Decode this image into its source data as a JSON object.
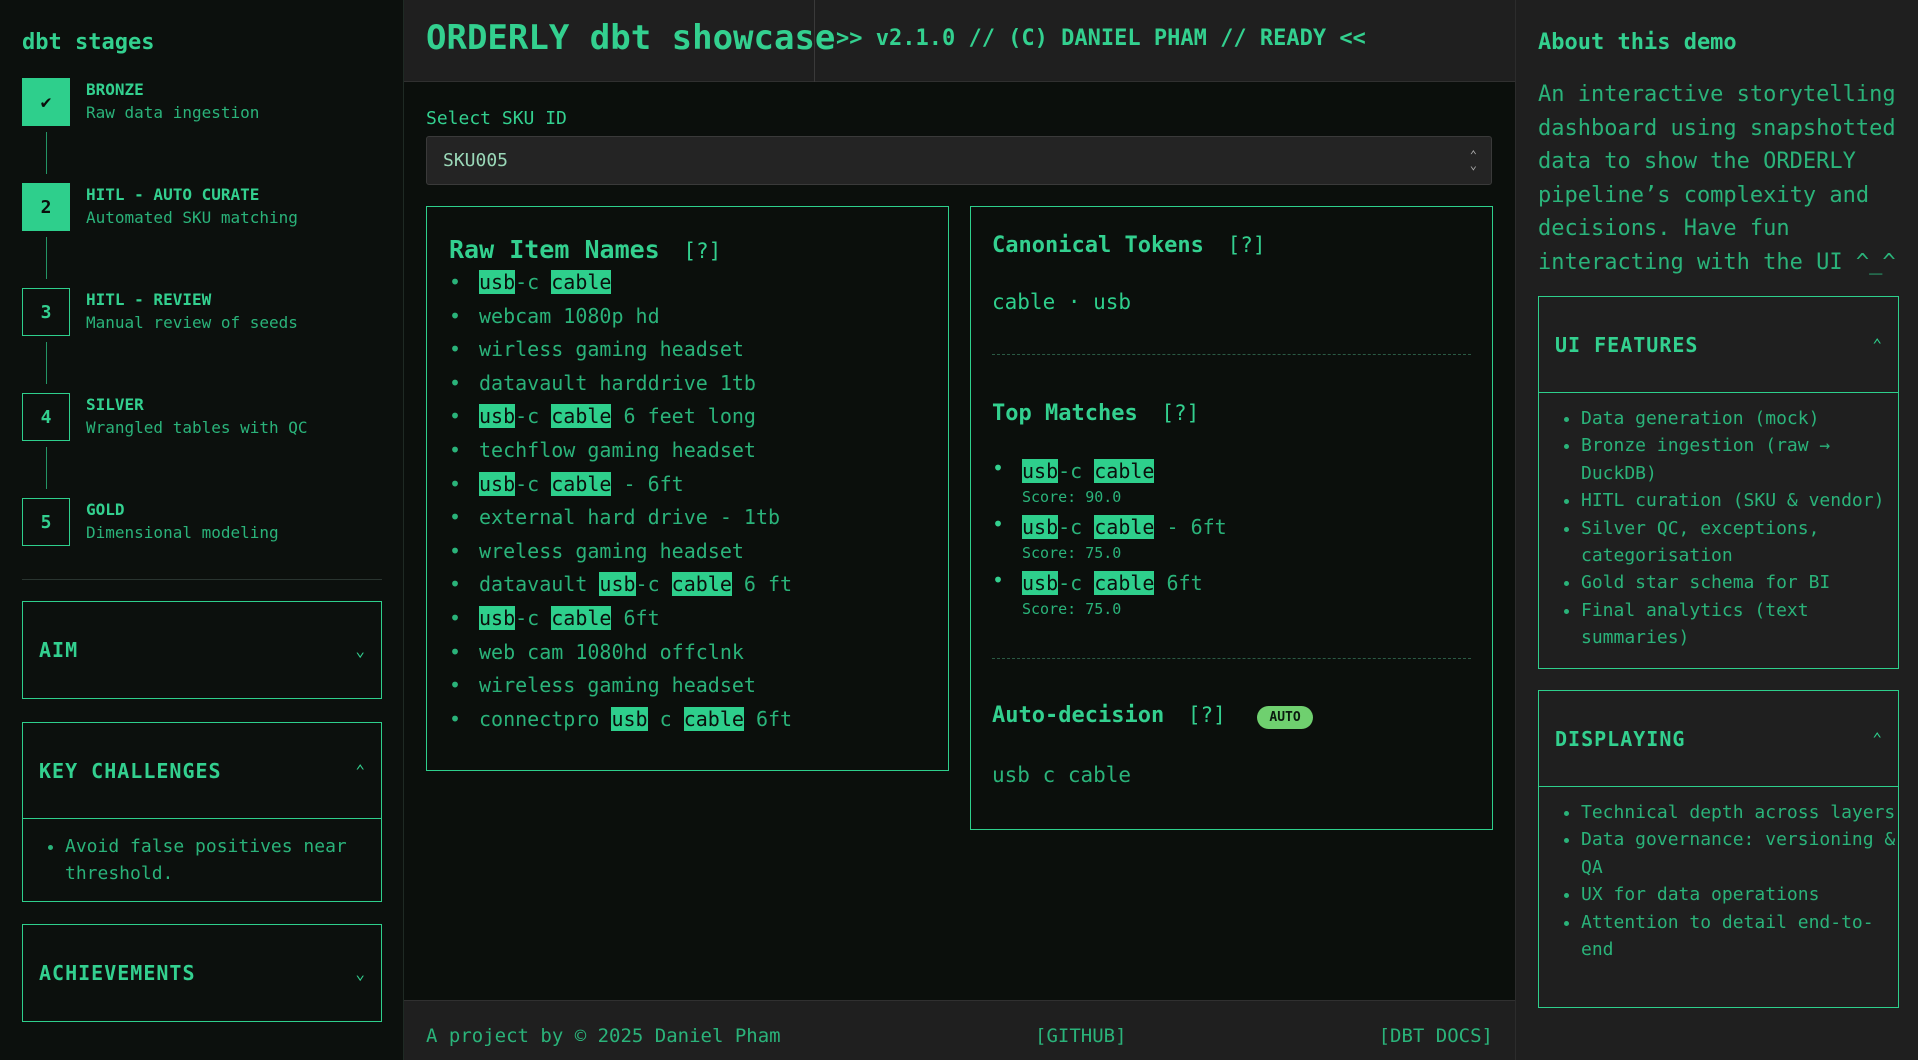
{
  "left": {
    "title": "dbt stages",
    "stages": [
      {
        "box": "✔",
        "name": "BRONZE",
        "desc": "Raw data ingestion"
      },
      {
        "box": "2",
        "name": "HITL - AUTO CURATE",
        "desc": "Automated SKU matching"
      },
      {
        "box": "3",
        "name": "HITL - REVIEW",
        "desc": "Manual review of seeds"
      },
      {
        "box": "4",
        "name": "SILVER",
        "desc": "Wrangled tables with QC"
      },
      {
        "box": "5",
        "name": "GOLD",
        "desc": "Dimensional modeling"
      }
    ],
    "accordions": {
      "aim": {
        "label": "AIM",
        "chevron": "⌄"
      },
      "challenges": {
        "label": "KEY CHALLENGES",
        "chevron": "⌃",
        "items": [
          "Avoid false positives near threshold."
        ]
      },
      "achievements": {
        "label": "ACHIEVEMENTS",
        "chevron": "⌄"
      }
    }
  },
  "topbar": {
    "brand": "ORDERLY dbt showcase",
    "status": ">> v2.1.0 // (C) DANIEL PHAM // READY <<"
  },
  "sku": {
    "label": "Select SKU ID",
    "value": "SKU005"
  },
  "raw": {
    "title": "Raw Item Names",
    "help": "[?]",
    "items": [
      [
        [
          "usb",
          true
        ],
        [
          "-c ",
          false
        ],
        [
          "cable",
          true
        ]
      ],
      [
        [
          "webcam 1080p hd",
          false
        ]
      ],
      [
        [
          "wirless gaming headset",
          false
        ]
      ],
      [
        [
          "datavault harddrive 1tb",
          false
        ]
      ],
      [
        [
          "usb",
          true
        ],
        [
          "-c ",
          false
        ],
        [
          "cable",
          true
        ],
        [
          " 6 feet long",
          false
        ]
      ],
      [
        [
          "techflow gaming headset",
          false
        ]
      ],
      [
        [
          "usb",
          true
        ],
        [
          "-c ",
          false
        ],
        [
          "cable",
          true
        ],
        [
          " - 6ft",
          false
        ]
      ],
      [
        [
          "external hard drive - 1tb",
          false
        ]
      ],
      [
        [
          "wreless gaming headset",
          false
        ]
      ],
      [
        [
          "datavault ",
          false
        ],
        [
          "usb",
          true
        ],
        [
          "-c ",
          false
        ],
        [
          "cable",
          true
        ],
        [
          " 6 ft",
          false
        ]
      ],
      [
        [
          "usb",
          true
        ],
        [
          "-c ",
          false
        ],
        [
          "cable",
          true
        ],
        [
          " 6ft",
          false
        ]
      ],
      [
        [
          "web cam 1080hd offclnk",
          false
        ]
      ],
      [
        [
          "wireless gaming headset",
          false
        ]
      ],
      [
        [
          "connectpro ",
          false
        ],
        [
          "usb",
          true
        ],
        [
          " c ",
          false
        ],
        [
          "cable",
          true
        ],
        [
          " 6ft",
          false
        ]
      ]
    ]
  },
  "canonical": {
    "title": "Canonical Tokens",
    "help": "[?]",
    "tokens": "cable · usb"
  },
  "matches": {
    "title": "Top Matches",
    "help": "[?]",
    "items": [
      {
        "parts": [
          [
            "usb",
            true
          ],
          [
            "-c ",
            false
          ],
          [
            "cable",
            true
          ]
        ],
        "score": "Score: 90.0"
      },
      {
        "parts": [
          [
            "usb",
            true
          ],
          [
            "-c ",
            false
          ],
          [
            "cable",
            true
          ],
          [
            " - 6ft",
            false
          ]
        ],
        "score": "Score: 75.0"
      },
      {
        "parts": [
          [
            "usb",
            true
          ],
          [
            "-c ",
            false
          ],
          [
            "cable",
            true
          ],
          [
            " 6ft",
            false
          ]
        ],
        "score": "Score: 75.0"
      }
    ]
  },
  "decision": {
    "title": "Auto-decision",
    "help": "[?]",
    "badge": "AUTO",
    "value": "usb c cable"
  },
  "footer": {
    "credit": "A project by © 2025 Daniel Pham",
    "github": "[GITHUB]",
    "docs": "[DBT DOCS]"
  },
  "right": {
    "about_title": "About this demo",
    "about_text": "An interactive storytelling dashboard using snapshotted data to show the ORDERLY pipeline’s complexity and decisions. Have fun interacting with the UI ^_^",
    "features": {
      "label": "UI FEATURES",
      "chevron": "⌃",
      "items": [
        "Data generation (mock)",
        "Bronze ingestion (raw → DuckDB)",
        "HITL curation (SKU & vendor)",
        "Silver QC, exceptions, categorisation",
        "Gold star schema for BI",
        "Final analytics (text summaries)"
      ]
    },
    "displaying": {
      "label": "DISPLAYING",
      "chevron": "⌃",
      "items": [
        "Technical depth across layers",
        "Data governance: versioning & QA",
        "UX for data operations",
        "Attention to detail end-to-end"
      ]
    }
  },
  "colors": {
    "accent": "#2ecf8c",
    "background": "#0b0f0c",
    "panel": "#1f1f1f",
    "badge": "#6fd06f"
  }
}
